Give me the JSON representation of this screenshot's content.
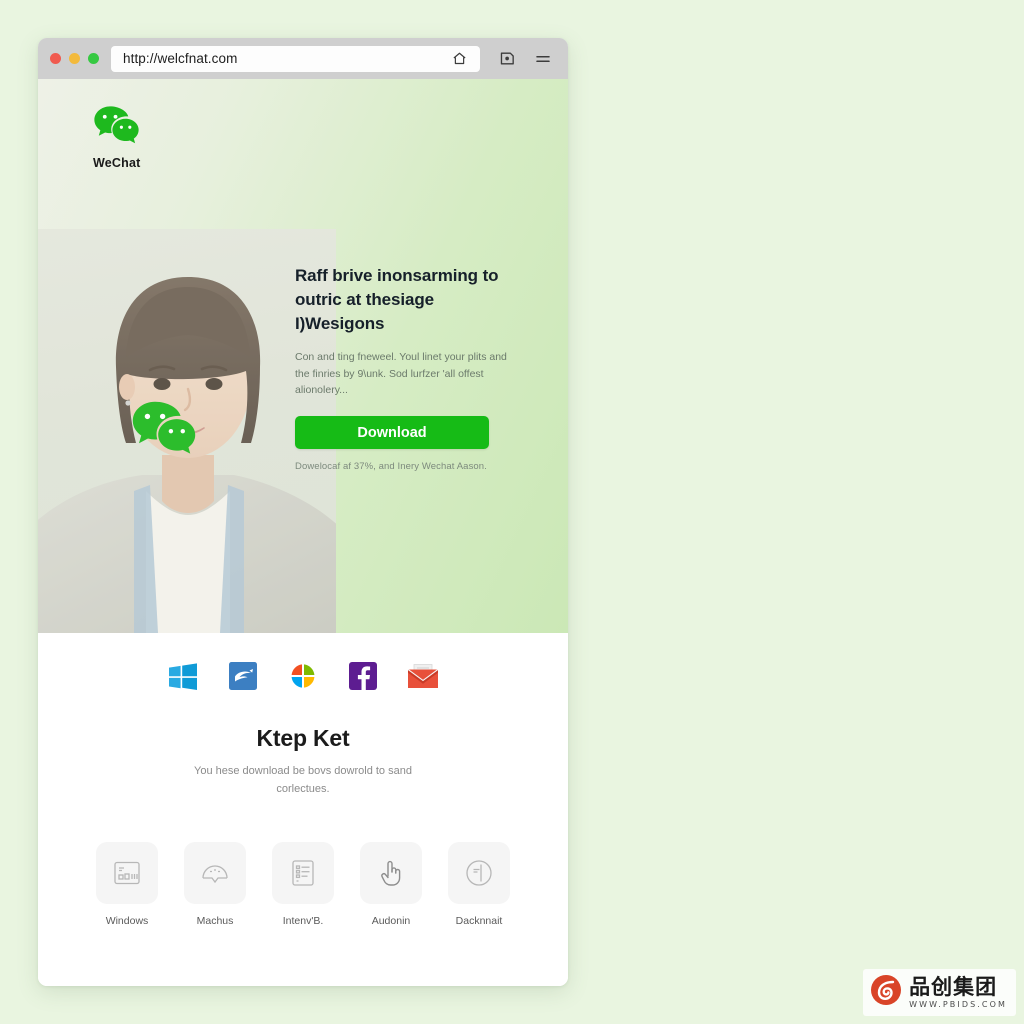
{
  "browser": {
    "url": "http://welcfnat.com",
    "traffic_lights": [
      "close-red",
      "minimize-yellow",
      "maximize-green"
    ],
    "home_icon": "home-icon",
    "bookmark_icon": "bookmark-tab-icon",
    "menu_icon": "hamburger-menu-icon"
  },
  "hero": {
    "brand_name": "WeChat",
    "brand_logo_icon": "wechat-logo-icon",
    "face_overlay_icon": "wechat-logo-icon",
    "headline_line1": "Raff brive inonsarming to",
    "headline_line2": "outric at thesiage I)Wesigons",
    "subcopy": "Con and ting fneweel. Youl linet your plits and the finries by 9\\unk. Sod lurfzer 'all offest alionolery...",
    "download_label": "Download",
    "download_note": "Dowelocaf af 37%, and Inery Wechat Aason.",
    "accent_color": "#16bb16"
  },
  "platforms": [
    {
      "name": "windows-logo-icon",
      "color": "#1ba1e2"
    },
    {
      "name": "blue-app-icon",
      "color": "#3a7ebf"
    },
    {
      "name": "pinwheel-icon",
      "color": "#f25022"
    },
    {
      "name": "facebook-icon",
      "color": "#5b1d8f"
    },
    {
      "name": "mail-envelope-icon",
      "color": "#e24b38"
    }
  ],
  "section": {
    "title": "Ktep Ket",
    "subtitle_line1": "You hese download be bovs dowrold to",
    "subtitle_line2": "sand corlectues."
  },
  "cards": [
    {
      "label": "Windows",
      "icon": "dashboard-panel-icon"
    },
    {
      "label": "Machus",
      "icon": "arc-fan-icon"
    },
    {
      "label": "Intenv'B.",
      "icon": "document-list-icon"
    },
    {
      "label": "Audonin",
      "icon": "pointing-hand-icon"
    },
    {
      "label": "Dacknnait",
      "icon": "circle-pointer-icon"
    }
  ],
  "watermark": {
    "brand_cn": "品创集团",
    "url": "WWW.PBIDS.COM",
    "logo_icon": "leaf-swirl-logo-icon",
    "logo_color": "#d94428"
  }
}
